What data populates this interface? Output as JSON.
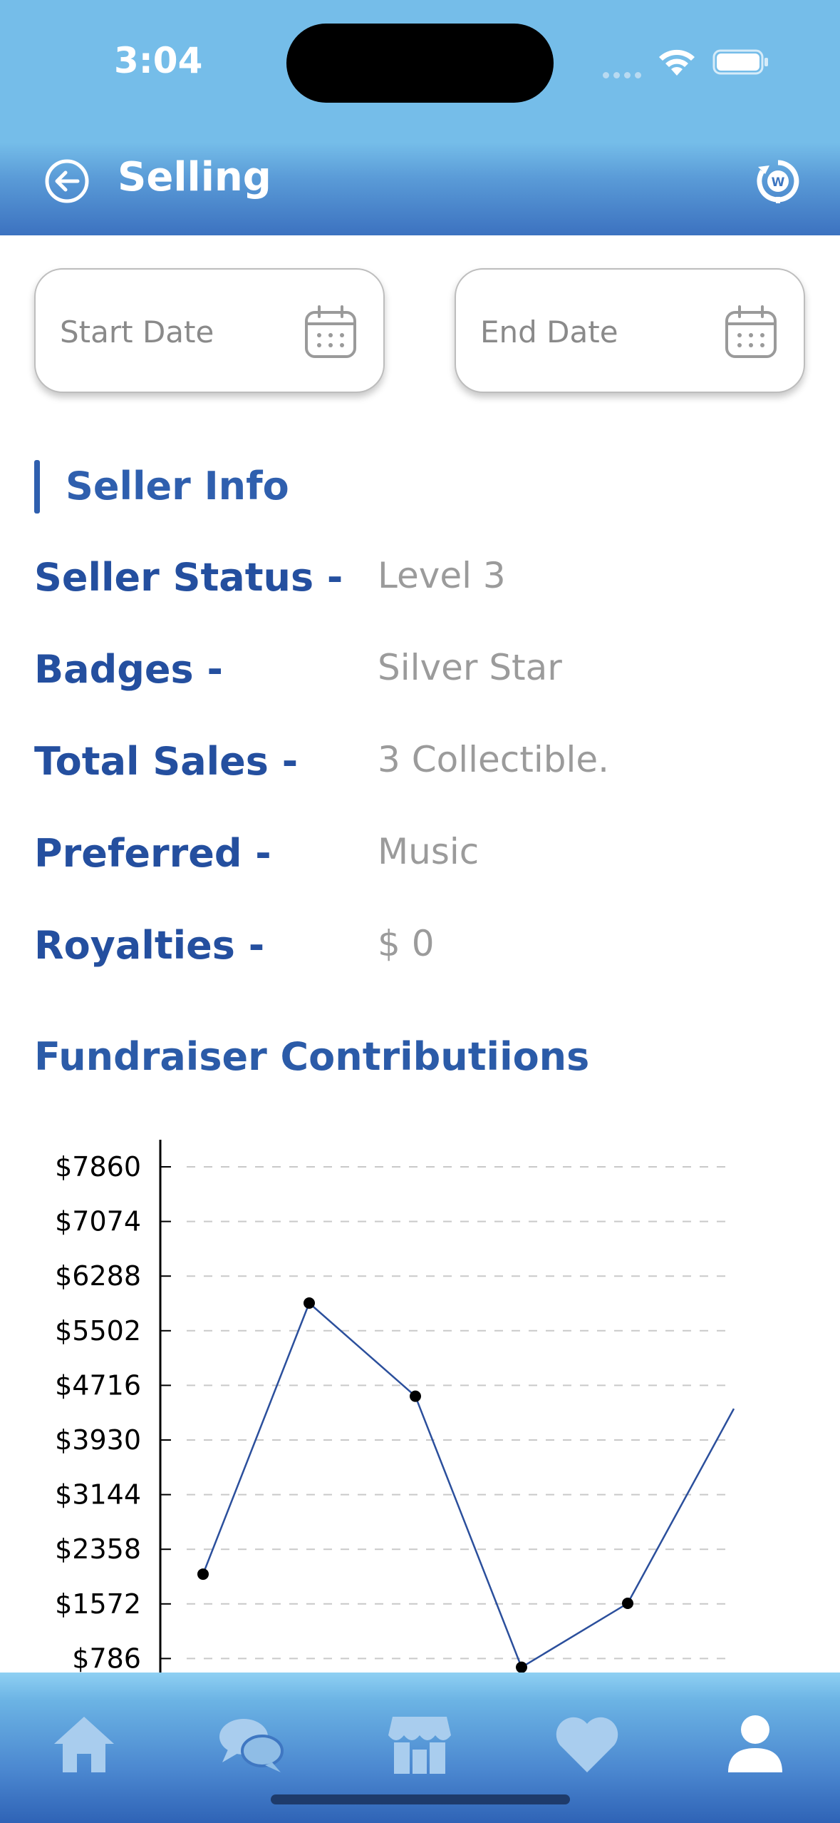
{
  "status_bar": {
    "time": "3:04"
  },
  "header": {
    "title": "Selling",
    "back_icon": "back-arrow-circle-icon",
    "action_icon": "wallet-sync-icon"
  },
  "date_range": {
    "start_placeholder": "Start Date",
    "end_placeholder": "End Date"
  },
  "seller_info": {
    "title": "Seller Info",
    "rows": [
      {
        "label": "Seller Status  -",
        "value": "Level 3"
      },
      {
        "label": "Badges  -",
        "value": "Silver Star"
      },
      {
        "label": "Total Sales  -",
        "value": "3 Collectible."
      },
      {
        "label": "Preferred  -",
        "value": "Music"
      },
      {
        "label": "Royalties  -",
        "value": "$ 0"
      }
    ]
  },
  "fundraiser": {
    "title": "Fundraiser Contributiions"
  },
  "chart_data": {
    "type": "line",
    "y_ticks": [
      "$7860",
      "$7074",
      "$6288",
      "$5502",
      "$4716",
      "$3930",
      "$3144",
      "$2358",
      "$1572",
      "$786"
    ],
    "y_tick_values": [
      7860,
      7074,
      6288,
      5502,
      4716,
      3930,
      3144,
      2358,
      1572,
      786
    ],
    "values": [
      2000,
      5900,
      4560,
      660,
      1580,
      4380
    ],
    "last_point_marker": false,
    "grid": "dashed-horizontal",
    "line_color": "#2b4f9c"
  },
  "bottom_nav": [
    {
      "icon": "home-icon",
      "active": false
    },
    {
      "icon": "chat-icon",
      "active": false
    },
    {
      "icon": "store-icon",
      "active": false
    },
    {
      "icon": "heart-icon",
      "active": false
    },
    {
      "icon": "profile-icon",
      "active": true
    }
  ]
}
